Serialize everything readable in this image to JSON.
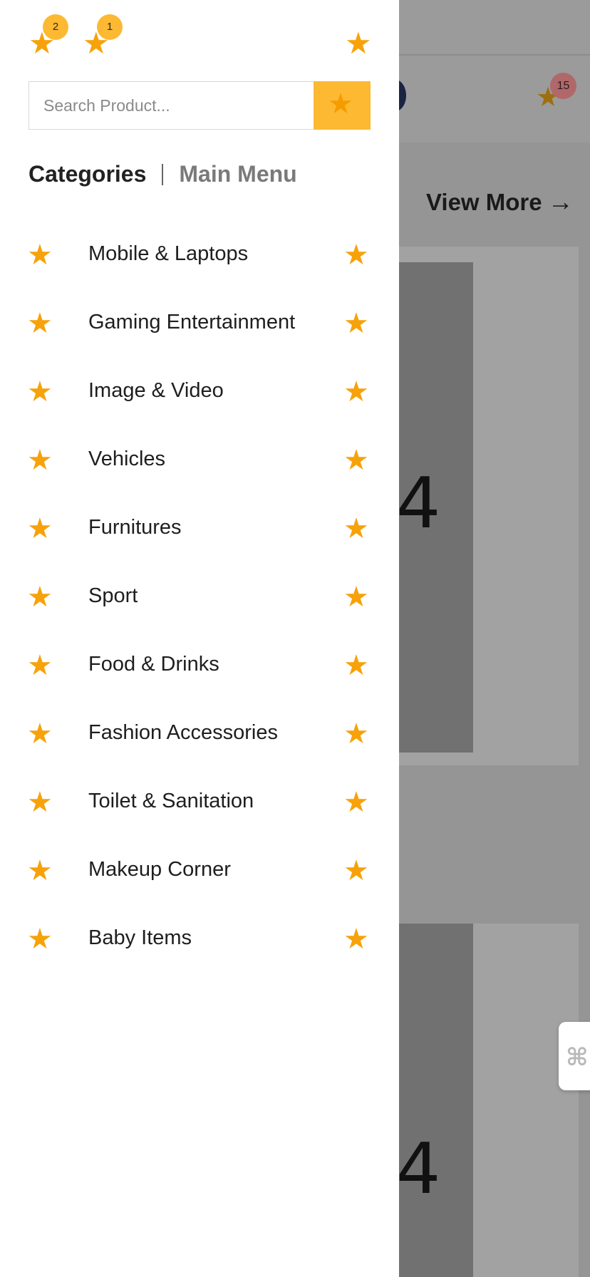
{
  "colors": {
    "accent": "#f7a20a",
    "search_button": "#fdb932",
    "badge": "#fdb931",
    "overlay": "#9b9b9b"
  },
  "drawer": {
    "top_icons": [
      {
        "icon": "star-icon",
        "badge": "2"
      },
      {
        "icon": "star-icon",
        "badge": "1"
      }
    ],
    "close_icon": "star-icon",
    "search": {
      "placeholder": "Search Product...",
      "value": "",
      "button_icon": "star-icon"
    },
    "tabs": [
      {
        "label": "Categories",
        "active": true
      },
      {
        "label": "Main Menu",
        "active": false
      }
    ],
    "categories": [
      {
        "label": "Mobile & Laptops"
      },
      {
        "label": "Gaming Entertainment"
      },
      {
        "label": "Image & Video"
      },
      {
        "label": "Vehicles"
      },
      {
        "label": "Furnitures"
      },
      {
        "label": "Sport"
      },
      {
        "label": "Food & Drinks"
      },
      {
        "label": "Fashion Accessories"
      },
      {
        "label": "Toilet & Sanitation"
      },
      {
        "label": "Makeup Corner"
      },
      {
        "label": "Baby Items"
      }
    ]
  },
  "background": {
    "cart_badge": "15",
    "view_more": "View More",
    "view_more_arrow": "→",
    "card_number_1": "4",
    "card_number_2": "4",
    "widget_glyph": "⌘"
  }
}
